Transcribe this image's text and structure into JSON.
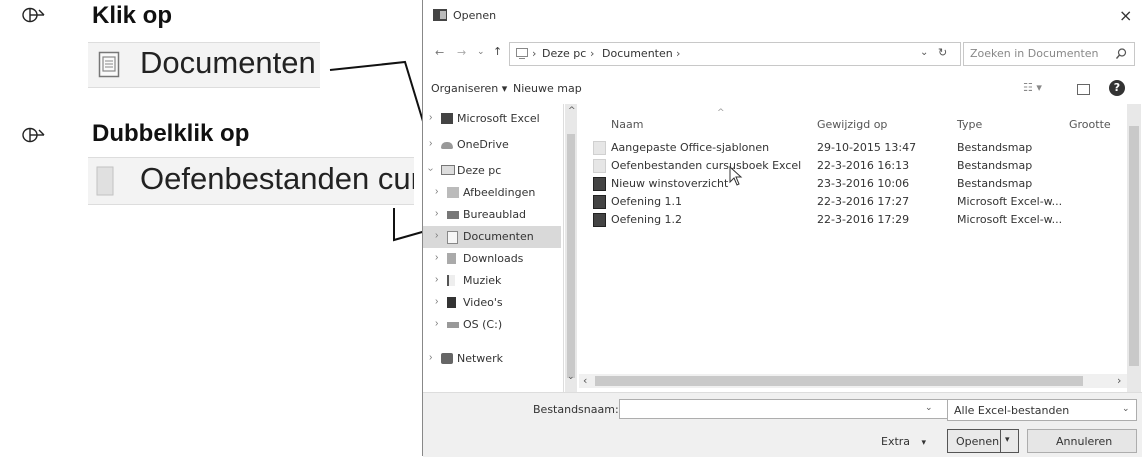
{
  "instructions": {
    "step1": {
      "action": "Klik op",
      "target": "Documenten"
    },
    "step2": {
      "action": "Dubbelklik op",
      "target": "Oefenbestanden cur"
    }
  },
  "dialog": {
    "title": "Openen",
    "close": "×",
    "breadcrumb": [
      "Deze pc",
      "Documenten"
    ],
    "search_placeholder": "Zoeken in Documenten",
    "toolbar": {
      "organize": "Organiseren ▾",
      "new_folder": "Nieuwe map"
    },
    "nav": [
      {
        "label": "Microsoft Excel",
        "icon": "excel-icon"
      },
      {
        "label": "OneDrive",
        "icon": "cloud-icon"
      },
      {
        "label": "Deze pc",
        "icon": "pc-icon"
      },
      {
        "label": "Afbeeldingen",
        "icon": "pictures-icon"
      },
      {
        "label": "Bureaublad",
        "icon": "desktop-icon"
      },
      {
        "label": "Documenten",
        "icon": "documents-icon"
      },
      {
        "label": "Downloads",
        "icon": "downloads-icon"
      },
      {
        "label": "Muziek",
        "icon": "music-icon"
      },
      {
        "label": "Video's",
        "icon": "video-icon"
      },
      {
        "label": "OS (C:)",
        "icon": "drive-icon"
      },
      {
        "label": "Netwerk",
        "icon": "network-icon"
      }
    ],
    "columns": {
      "name": "Naam",
      "modified": "Gewijzigd op",
      "type": "Type",
      "size": "Grootte"
    },
    "files": [
      {
        "name": "Aangepaste Office-sjablonen",
        "modified": "29-10-2015 13:47",
        "type": "Bestandsmap",
        "kind": "folder"
      },
      {
        "name": "Oefenbestanden cursusboek Excel",
        "modified": "22-3-2016 16:13",
        "type": "Bestandsmap",
        "kind": "folder"
      },
      {
        "name": "Nieuw winstoverzicht",
        "modified": "23-3-2016 10:06",
        "type": "Bestandsmap",
        "kind": "excel"
      },
      {
        "name": "Oefening 1.1",
        "modified": "22-3-2016 17:27",
        "type": "Microsoft Excel-w...",
        "kind": "excel"
      },
      {
        "name": "Oefening 1.2",
        "modified": "22-3-2016 17:29",
        "type": "Microsoft Excel-w...",
        "kind": "excel"
      }
    ],
    "footer": {
      "filename_label": "Bestandsnaam:",
      "filename_value": "",
      "filter": "Alle Excel-bestanden",
      "extra": "Extra",
      "open": "Openen",
      "cancel": "Annuleren"
    }
  }
}
